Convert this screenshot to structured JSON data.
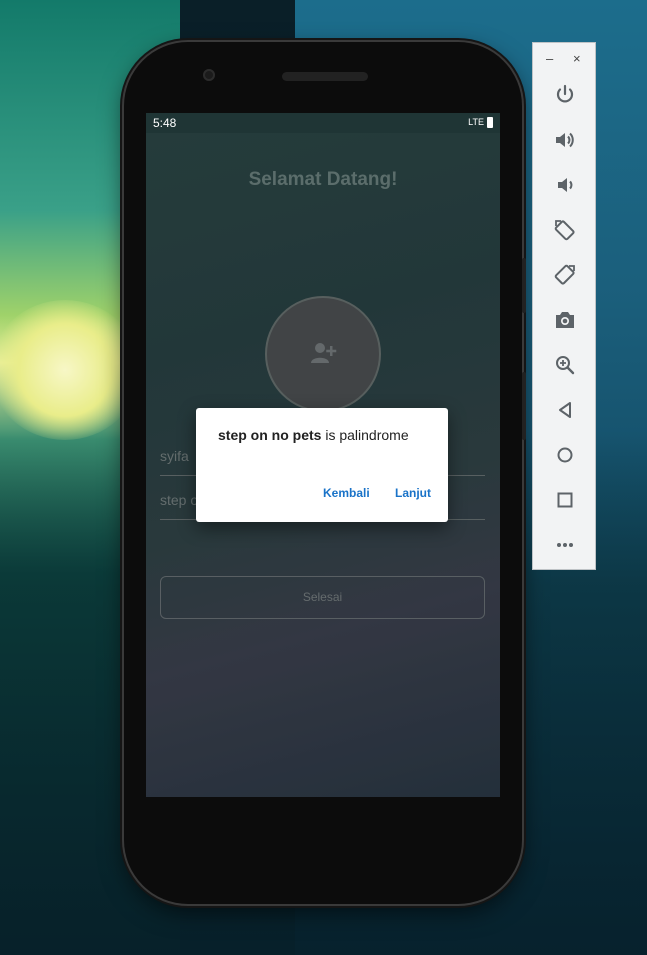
{
  "status_bar": {
    "time": "5:48",
    "network": "LTE"
  },
  "app": {
    "title": "Selamat Datang!",
    "avatar_icon": "add-person-icon",
    "name_field_value": "syifa",
    "sentence_field_value": "step o",
    "submit_label": "Selesai"
  },
  "dialog": {
    "message_bold": "step on no pets",
    "message_rest": " is palindrome",
    "negative_label": "Kembali",
    "positive_label": "Lanjut",
    "button_color": "#1a73c8"
  },
  "nav_bar": {
    "icons": [
      "back-icon",
      "home-icon",
      "recents-icon"
    ]
  },
  "emulator_toolbar": {
    "minimize_label": "–",
    "close_label": "×",
    "icons": [
      "power-icon",
      "volume-up-icon",
      "volume-down-icon",
      "rotate-left-icon",
      "rotate-right-icon",
      "camera-icon",
      "zoom-icon",
      "back-icon",
      "home-icon",
      "overview-icon",
      "more-icon"
    ]
  }
}
